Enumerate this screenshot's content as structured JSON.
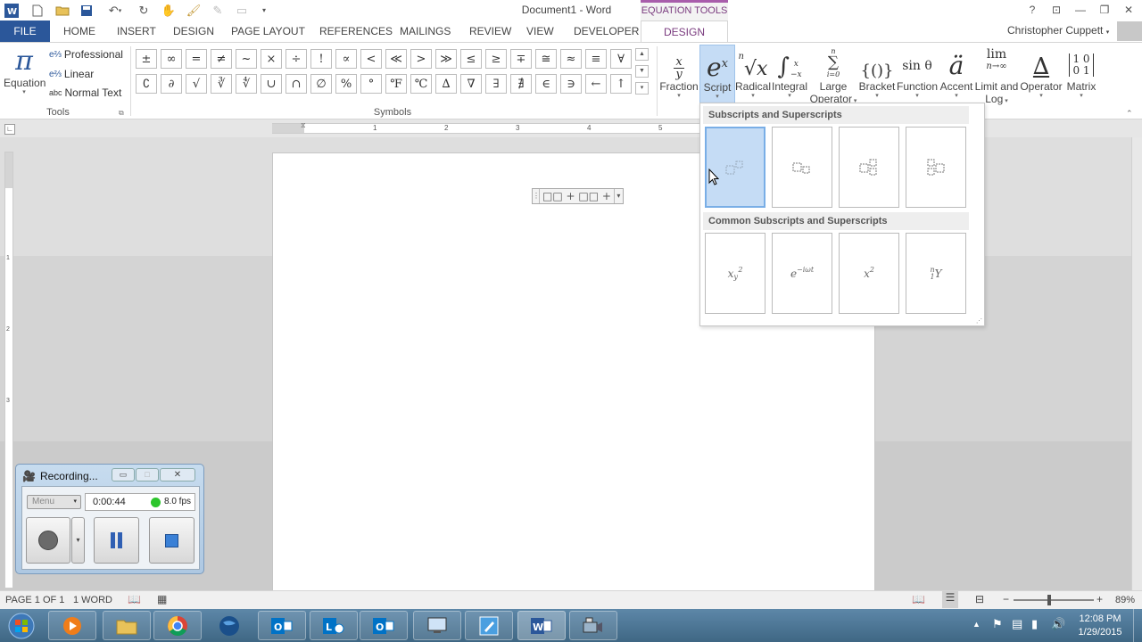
{
  "window": {
    "doc_title": "Document1 - Word",
    "context_tools": "EQUATION TOOLS",
    "user": "Christopher Cuppett"
  },
  "tabs": {
    "file": "FILE",
    "items": [
      "HOME",
      "INSERT",
      "DESIGN",
      "PAGE LAYOUT",
      "REFERENCES",
      "MAILINGS",
      "REVIEW",
      "VIEW",
      "DEVELOPER"
    ],
    "active": "DESIGN"
  },
  "tools_group": {
    "equation_label": "Equation",
    "professional": "Professional",
    "linear": "Linear",
    "normal_text_prefix": "abc",
    "normal_text": "Normal Text",
    "label": "Tools"
  },
  "symbols": {
    "label": "Symbols",
    "row1": [
      "±",
      "∞",
      "=",
      "≠",
      "~",
      "×",
      "÷",
      "!",
      "∝",
      "<",
      "≪",
      ">",
      "≫",
      "≤",
      "≥",
      "∓",
      "≅",
      "≈",
      "≡",
      "∀"
    ],
    "row2": [
      "∁",
      "∂",
      "√",
      "∛",
      "∜",
      "∪",
      "∩",
      "∅",
      "%",
      "°",
      "℉",
      "℃",
      "∆",
      "∇",
      "∃",
      "∄",
      "∈",
      "∋",
      "←",
      "↑"
    ]
  },
  "structures": [
    {
      "label": "Fraction",
      "caret": true
    },
    {
      "label": "Script",
      "caret": true
    },
    {
      "label": "Radical",
      "caret": true
    },
    {
      "label": "Integral",
      "caret": true
    },
    {
      "label": "Large",
      "label2": "Operator",
      "caret": true
    },
    {
      "label": "Bracket",
      "caret": true
    },
    {
      "label": "Function",
      "caret": true
    },
    {
      "label": "Accent",
      "caret": true
    },
    {
      "label": "Limit and",
      "label2": "Log",
      "caret": true
    },
    {
      "label": "Operator",
      "caret": true
    },
    {
      "label": "Matrix",
      "caret": true
    }
  ],
  "structure_glyphs": {
    "fraction_top": "x",
    "fraction_bottom": "y",
    "script": "e",
    "script_sup": "x",
    "radical_index": "n",
    "radical": "√x",
    "integral": "∫",
    "integral_upper": "x",
    "integral_lower": "−x",
    "large_op": "∑",
    "large_op_upper": "n",
    "large_op_lower": "i=0",
    "bracket": "{()}",
    "function": "sin θ",
    "accent": "ä",
    "limit": "lim",
    "limit_sub": "n→∞",
    "operator": "∆",
    "matrix": [
      "1 0",
      "0 1"
    ]
  },
  "gallery": {
    "section1": "Subscripts and Superscripts",
    "section2": "Common Subscripts and Superscripts",
    "common": [
      {
        "base": "x",
        "sub": "y",
        "sup": "2"
      },
      {
        "base": "e",
        "sup": "−iωt"
      },
      {
        "base": "x",
        "sup": "2"
      },
      {
        "pre_sup": "n",
        "pre_sub": "1",
        "base": "Y"
      }
    ]
  },
  "equation": {
    "text": "□□ + □□ +"
  },
  "ruler": {
    "numbers": [
      "1",
      "2",
      "3",
      "4",
      "5"
    ],
    "left_numbers": [
      "1",
      "2",
      "3"
    ]
  },
  "status": {
    "page": "PAGE 1 OF 1",
    "words": "1 WORD",
    "zoom": "89%"
  },
  "recording": {
    "title": "Recording...",
    "menu": "Menu",
    "time": "0:00:44",
    "fps": "8.0 fps"
  },
  "clock": {
    "time": "12:08 PM",
    "date": "1/29/2015"
  },
  "colors": {
    "word_blue": "#2b579a",
    "eq_tools": "#a85dab",
    "gallery_selected": "#c5dcf5"
  }
}
